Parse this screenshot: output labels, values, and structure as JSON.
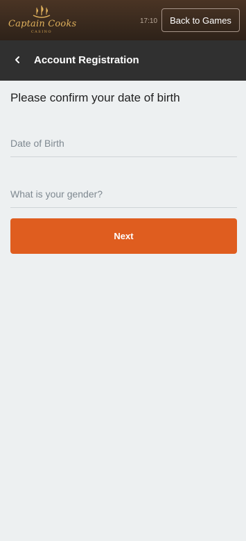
{
  "header": {
    "logo_text": "Captain Cooks",
    "logo_subtext": "CASINO",
    "time": "17:10",
    "back_button_label": "Back to Games"
  },
  "subheader": {
    "back_icon": "chevron-left-icon",
    "title": "Account Registration"
  },
  "form": {
    "heading": "Please confirm your date of birth",
    "dob": {
      "value": "",
      "placeholder": "Date of Birth"
    },
    "gender": {
      "value": "",
      "placeholder": "What is your gender?"
    },
    "next_label": "Next"
  },
  "colors": {
    "topbar": "#3a2a1e",
    "subheader": "#303030",
    "background": "#edf0f1",
    "accent": "#df5d1f",
    "logo_gold": "#e0b15c"
  }
}
